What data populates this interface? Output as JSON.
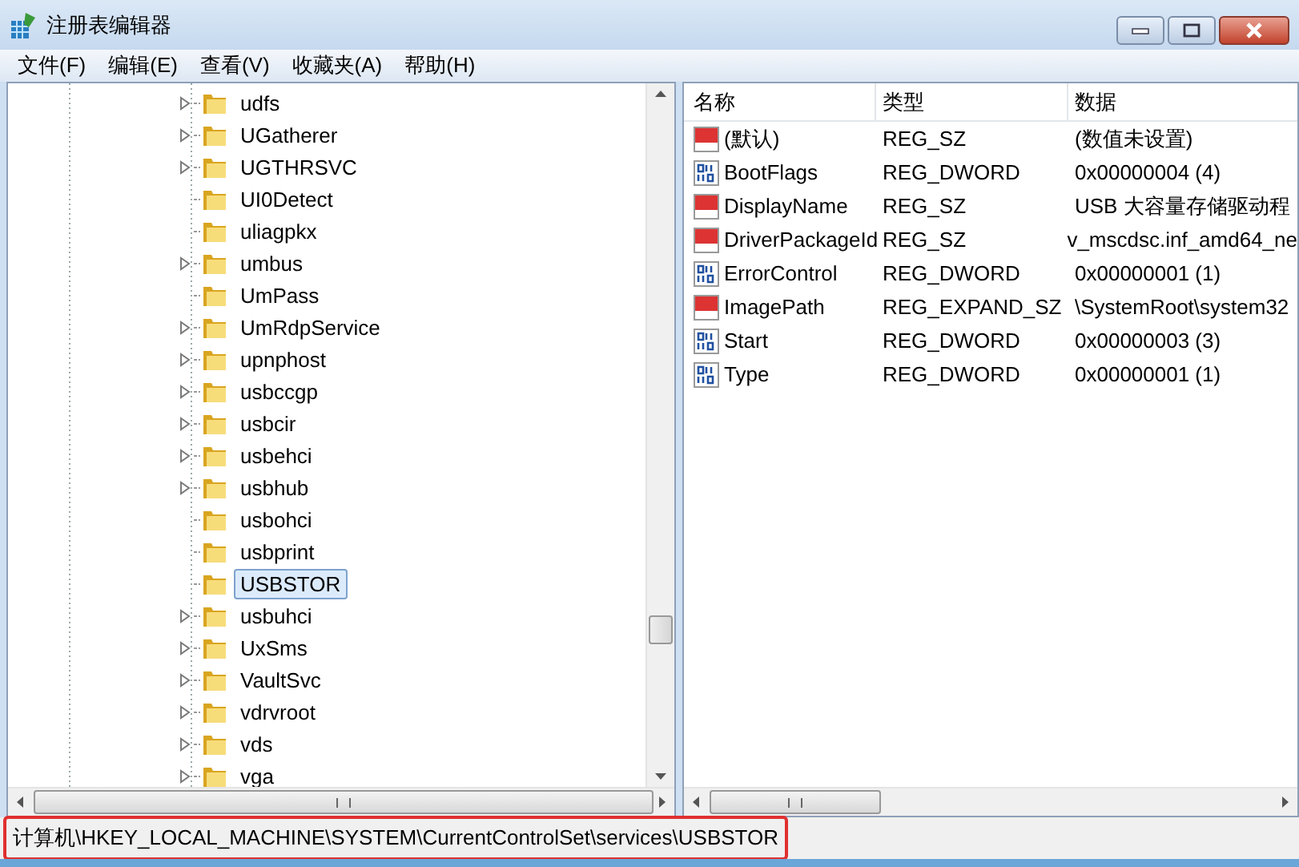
{
  "window": {
    "title": "注册表编辑器"
  },
  "menu": [
    "文件(F)",
    "编辑(E)",
    "查看(V)",
    "收藏夹(A)",
    "帮助(H)"
  ],
  "tree": {
    "items": [
      {
        "label": "udfs",
        "expandable": true,
        "selected": false
      },
      {
        "label": "UGatherer",
        "expandable": true,
        "selected": false
      },
      {
        "label": "UGTHRSVC",
        "expandable": true,
        "selected": false
      },
      {
        "label": "UI0Detect",
        "expandable": false,
        "selected": false
      },
      {
        "label": "uliagpkx",
        "expandable": false,
        "selected": false
      },
      {
        "label": "umbus",
        "expandable": true,
        "selected": false
      },
      {
        "label": "UmPass",
        "expandable": false,
        "selected": false
      },
      {
        "label": "UmRdpService",
        "expandable": true,
        "selected": false
      },
      {
        "label": "upnphost",
        "expandable": true,
        "selected": false
      },
      {
        "label": "usbccgp",
        "expandable": true,
        "selected": false
      },
      {
        "label": "usbcir",
        "expandable": true,
        "selected": false
      },
      {
        "label": "usbehci",
        "expandable": true,
        "selected": false
      },
      {
        "label": "usbhub",
        "expandable": true,
        "selected": false
      },
      {
        "label": "usbohci",
        "expandable": false,
        "selected": false
      },
      {
        "label": "usbprint",
        "expandable": false,
        "selected": false
      },
      {
        "label": "USBSTOR",
        "expandable": false,
        "selected": true
      },
      {
        "label": "usbuhci",
        "expandable": true,
        "selected": false
      },
      {
        "label": "UxSms",
        "expandable": true,
        "selected": false
      },
      {
        "label": "VaultSvc",
        "expandable": true,
        "selected": false
      },
      {
        "label": "vdrvroot",
        "expandable": true,
        "selected": false
      },
      {
        "label": "vds",
        "expandable": true,
        "selected": false
      },
      {
        "label": "vga",
        "expandable": true,
        "selected": false
      }
    ]
  },
  "values": {
    "columns": [
      "名称",
      "类型",
      "数据"
    ],
    "rows": [
      {
        "kind": "string",
        "name": "(默认)",
        "type": "REG_SZ",
        "data": "(数值未设置)"
      },
      {
        "kind": "binary",
        "name": "BootFlags",
        "type": "REG_DWORD",
        "data": "0x00000004 (4)"
      },
      {
        "kind": "string",
        "name": "DisplayName",
        "type": "REG_SZ",
        "data": "USB 大容量存储驱动程"
      },
      {
        "kind": "string",
        "name": "DriverPackageId",
        "type": "REG_SZ",
        "data": "v_mscdsc.inf_amd64_ne"
      },
      {
        "kind": "binary",
        "name": "ErrorControl",
        "type": "REG_DWORD",
        "data": "0x00000001 (1)"
      },
      {
        "kind": "string",
        "name": "ImagePath",
        "type": "REG_EXPAND_SZ",
        "data": "\\SystemRoot\\system32"
      },
      {
        "kind": "binary",
        "name": "Start",
        "type": "REG_DWORD",
        "data": "0x00000003 (3)"
      },
      {
        "kind": "binary",
        "name": "Type",
        "type": "REG_DWORD",
        "data": "0x00000001 (1)"
      }
    ]
  },
  "status_bar": {
    "text": "计算机\\HKEY_LOCAL_MACHINE\\SYSTEM\\CurrentControlSet\\services\\USBSTOR",
    "highlighted": true
  }
}
